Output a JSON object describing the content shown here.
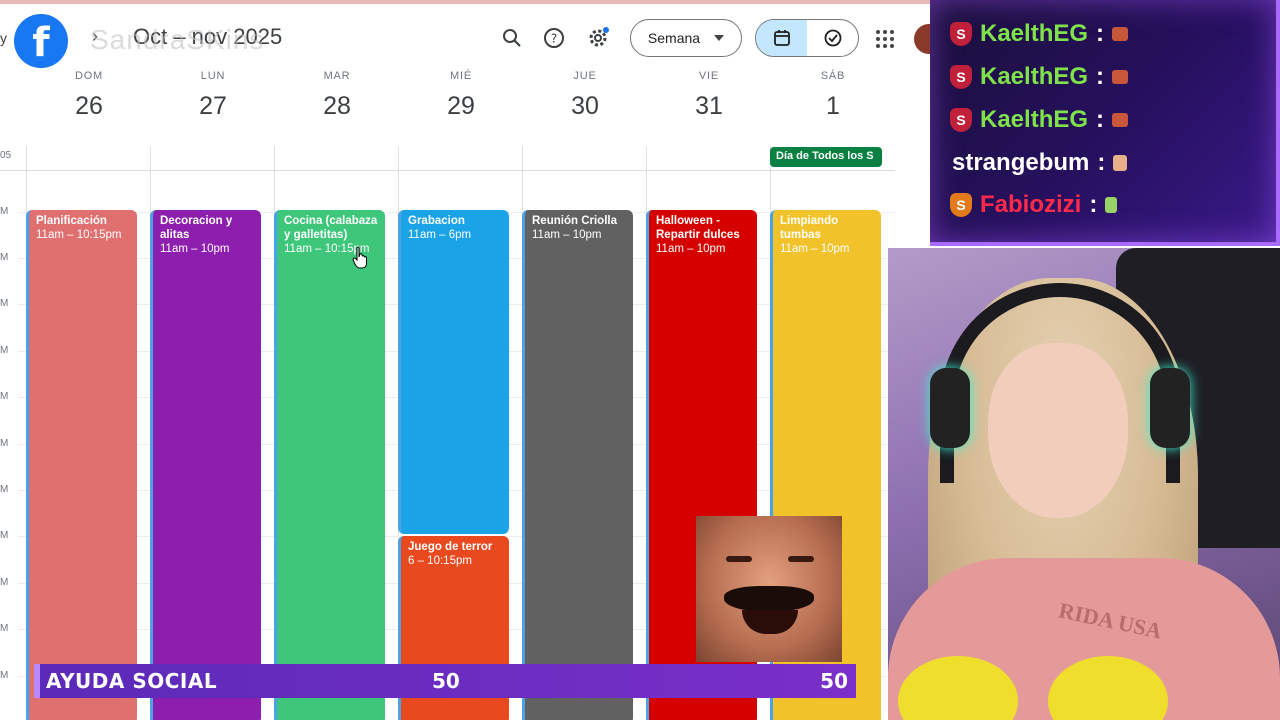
{
  "header": {
    "logo_letter": "f",
    "watermark": "SandraSKins",
    "today_label": "y",
    "prev_label": "‹",
    "next_label": "›",
    "period": "Oct – nov 2025",
    "view_select": "Semana",
    "icons": [
      "search-icon",
      "help-icon",
      "settings-icon",
      "calendar-icon",
      "tasks-icon",
      "apps-icon"
    ]
  },
  "timezone": "05",
  "days": [
    {
      "name": "DOM",
      "num": "26"
    },
    {
      "name": "LUN",
      "num": "27"
    },
    {
      "name": "MAR",
      "num": "28"
    },
    {
      "name": "MIÉ",
      "num": "29"
    },
    {
      "name": "JUE",
      "num": "30"
    },
    {
      "name": "VIE",
      "num": "31"
    },
    {
      "name": "SÁB",
      "num": "1"
    }
  ],
  "hour_labels": [
    "M",
    "M",
    "M",
    "M",
    "M",
    "M",
    "M",
    "M",
    "M",
    "M",
    "M"
  ],
  "allday_event": "Día de Todos los S",
  "events": [
    {
      "title": "Planificación",
      "time": "11am – 10:15pm",
      "color": "#e06f6f"
    },
    {
      "title": "Decoracion y alitas",
      "time": "11am – 10pm",
      "color": "#8e1fae"
    },
    {
      "title": "Cocina (calabaza y galletitas)",
      "time": "11am – 10:15pm",
      "color": "#3ec77a"
    },
    {
      "title": "Grabacion",
      "time": "11am – 6pm",
      "color": "#1aa3e6"
    },
    {
      "title": "Juego de terror",
      "time": "6 – 10:15pm",
      "color": "#e8491e"
    },
    {
      "title": "Reunión Criolla",
      "time": "11am – 10pm",
      "color": "#616161"
    },
    {
      "title": "Halloween - Repartir dulces",
      "time": "11am – 10pm",
      "color": "#d50000"
    },
    {
      "title": "Limpiando tumbas",
      "time": "11am – 10pm",
      "color": "#f2c22b"
    }
  ],
  "chat": [
    {
      "user": "KaelthEG",
      "color": "#7fe24a",
      "badge": "S",
      "badge_color": "#c0203a"
    },
    {
      "user": "KaelthEG",
      "color": "#7fe24a",
      "badge": "S",
      "badge_color": "#c0203a"
    },
    {
      "user": "KaelthEG",
      "color": "#7fe24a",
      "badge": "S",
      "badge_color": "#c0203a"
    },
    {
      "user": "strangebum",
      "color": "#ffffff",
      "badge": "",
      "badge_color": ""
    },
    {
      "user": "Fabiozizi",
      "color": "#ff2a4a",
      "badge": "S",
      "badge_color": "#e07a1a"
    }
  ],
  "chat_sep": ":",
  "social_bar": {
    "label": "AYUDA SOCIAL",
    "value1": "50",
    "value2": "50"
  },
  "sweater_text": "RIDA USA"
}
